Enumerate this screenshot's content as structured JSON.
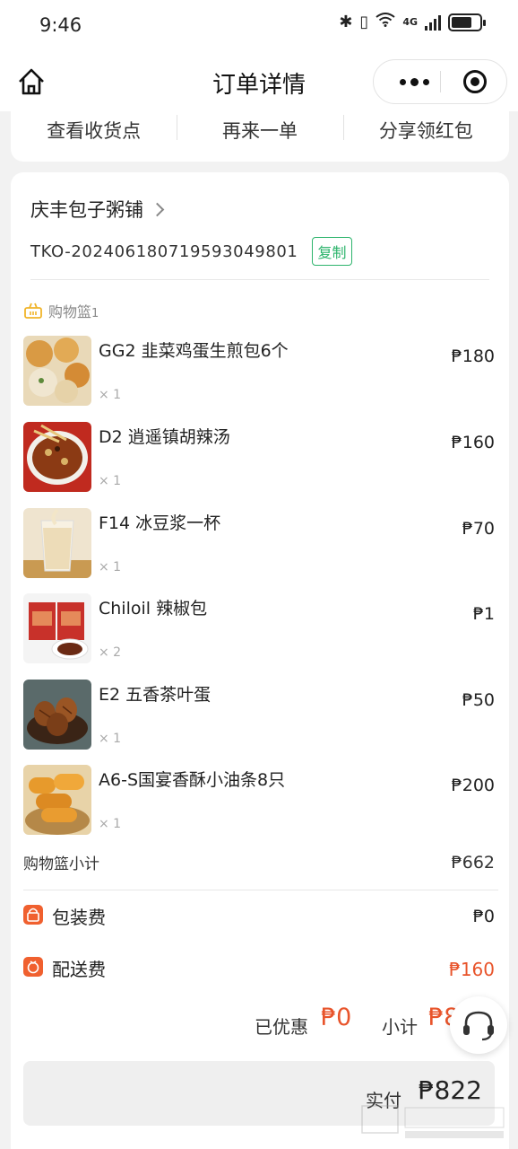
{
  "status_bar": {
    "time": "9:46",
    "network": "4G"
  },
  "nav": {
    "title": "订单详情"
  },
  "actions": [
    {
      "label": "查看收货点"
    },
    {
      "label": "再来一单"
    },
    {
      "label": "分享领红包"
    }
  ],
  "order": {
    "shop_name": "庆丰包子粥铺",
    "order_no": "TKO-20240618071959304980​1",
    "copy_label": "复制"
  },
  "basket": {
    "label": "购物篮",
    "index": "1",
    "items": [
      {
        "name": "GG2 韭菜鸡蛋生煎包6个",
        "qty": "× 1",
        "price": "₱180"
      },
      {
        "name": "D2 逍遥镇胡辣汤",
        "qty": "× 1",
        "price": "₱160"
      },
      {
        "name": "F14 冰豆浆一杯",
        "qty": "× 1",
        "price": "₱70"
      },
      {
        "name": "Chiloil 辣椒包",
        "qty": "× 2",
        "price": "₱1"
      },
      {
        "name": "E2 五香茶叶蛋",
        "qty": "× 1",
        "price": "₱50"
      },
      {
        "name": "A6-S国宴香酥小油条8只",
        "qty": "× 1",
        "price": "₱200"
      }
    ],
    "subtotal_label": "购物篮小计",
    "subtotal": "₱662"
  },
  "fees": {
    "packaging_label": "包装费",
    "packaging": "₱0",
    "delivery_label": "配送费",
    "delivery": "₱160"
  },
  "summary": {
    "discount_label": "已优惠",
    "discount": "₱0",
    "subtotal_label": "小计",
    "subtotal": "₱822"
  },
  "paid": {
    "label": "实付",
    "value": "₱822"
  },
  "colors": {
    "accent_red": "#e8542b",
    "copy_green": "#2db46c",
    "basket_yellow": "#f0b429"
  }
}
